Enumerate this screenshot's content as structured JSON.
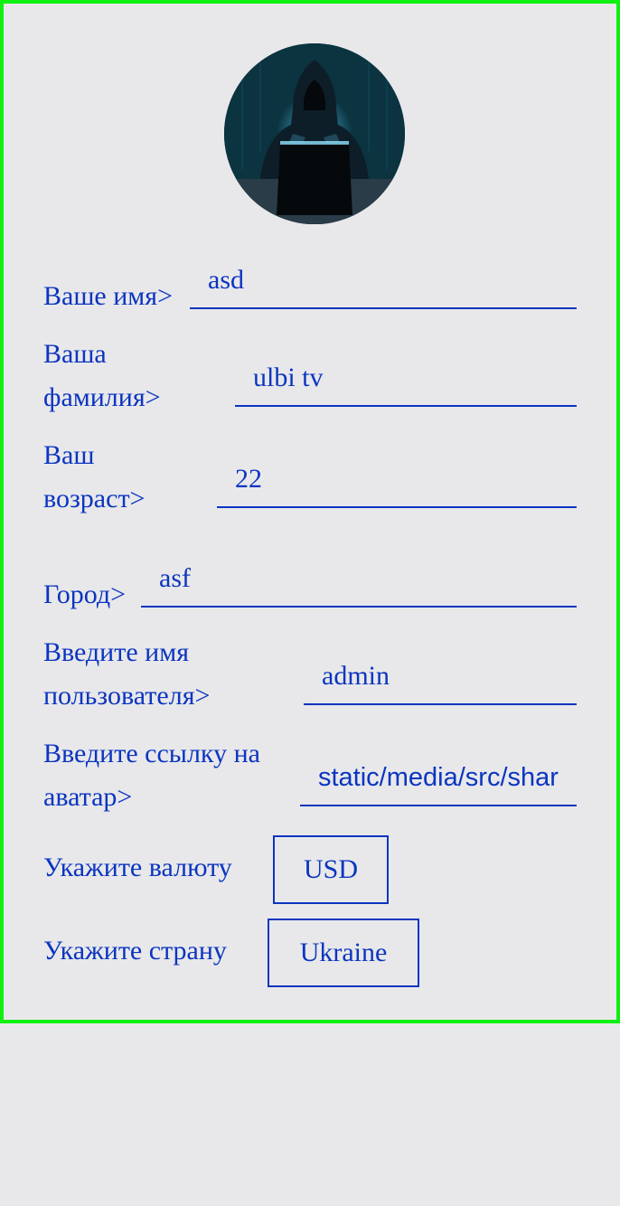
{
  "profile": {
    "first_name": {
      "label": "Ваше имя>",
      "value": "asd"
    },
    "last_name": {
      "label_line1": "Ваша",
      "label_line2": "фамилия>",
      "value": "ulbi tv"
    },
    "age": {
      "label_line1": "Ваш",
      "label_line2": "возраст>",
      "value": "22"
    },
    "city": {
      "label": "Город>",
      "value": "asf"
    },
    "username": {
      "label_line1": "Введите имя",
      "label_line2": "пользователя>",
      "value": "admin"
    },
    "avatar_url": {
      "label_line1": "Введите ссылку на",
      "label_line2": "аватар>",
      "value": "static/media/src/share"
    },
    "currency": {
      "label": "Укажите валюту",
      "selected": "USD"
    },
    "country": {
      "label": "Укажите страну",
      "selected": "Ukraine"
    }
  },
  "colors": {
    "accent": "#0b35c0",
    "border": "#10f010",
    "background": "#e8e8ea"
  },
  "icons": {
    "avatar": "hooded-hacker-avatar"
  }
}
